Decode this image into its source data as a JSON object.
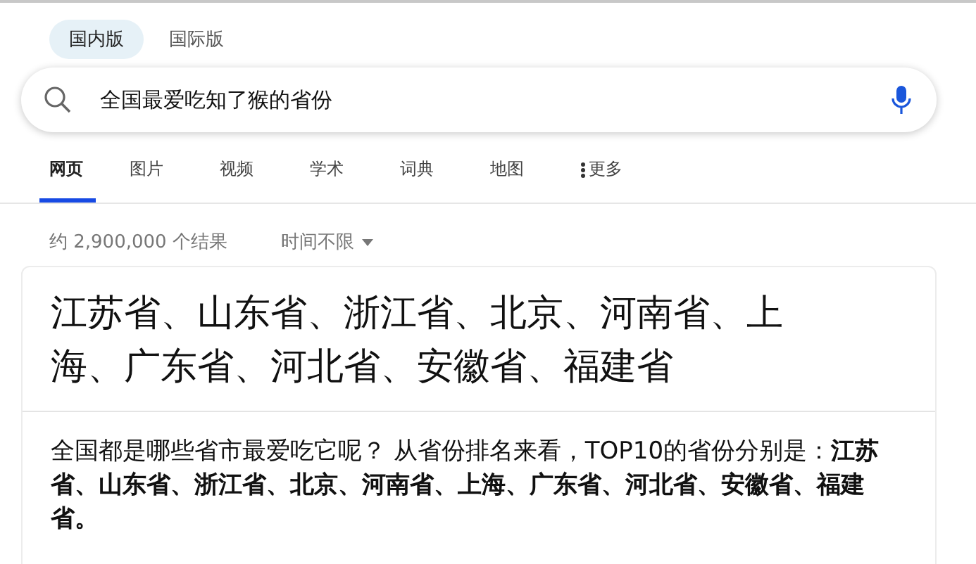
{
  "region_tabs": [
    {
      "label": "国内版",
      "selected": true
    },
    {
      "label": "国际版",
      "selected": false
    }
  ],
  "search": {
    "value": "全国最爱吃知了猴的省份"
  },
  "nav_tabs": [
    {
      "label": "网页",
      "selected": true
    },
    {
      "label": "图片",
      "selected": false
    },
    {
      "label": "视频",
      "selected": false
    },
    {
      "label": "学术",
      "selected": false
    },
    {
      "label": "词典",
      "selected": false
    },
    {
      "label": "地图",
      "selected": false
    },
    {
      "label": "更多",
      "selected": false,
      "kind": "more"
    }
  ],
  "result_count": "约 2,900,000 个结果",
  "time_filter": "时间不限",
  "answer": {
    "title": "江苏省、山东省、浙江省、北京、河南省、上海、广东省、河北省、安徽省、福建省",
    "snippet": "全国都是哪些省市最爱吃它呢？ 从省份排名来看，TOP10的省份分别是：**江苏省、山东省、浙江省、北京、河南省、上海、广东省、河北省、安徽省、福建省。**"
  }
}
